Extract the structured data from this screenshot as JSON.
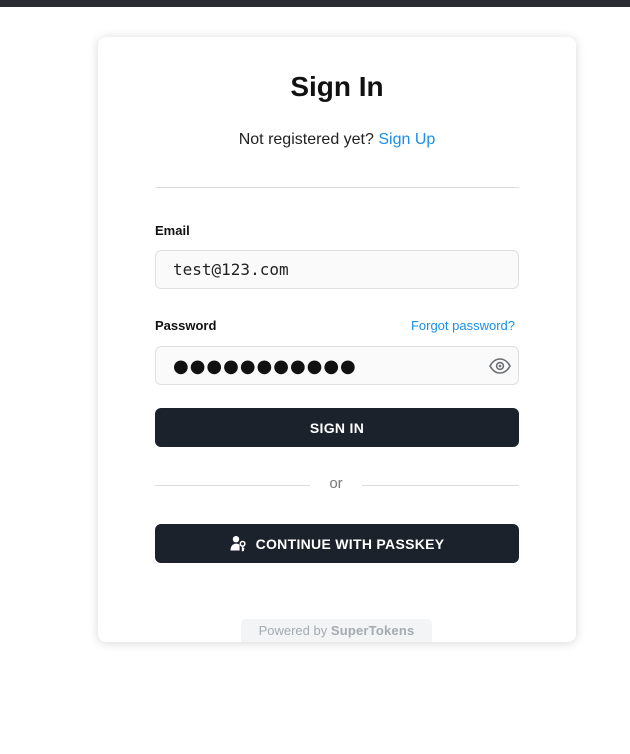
{
  "signin": {
    "title": "Sign In",
    "subtitle_prefix": "Not registered yet?",
    "signup_link": "Sign Up",
    "email_label": "Email",
    "email_value": "test@123.com",
    "password_label": "Password",
    "forgot_link": "Forgot password?",
    "password_masked": "●●●●●●●●●●●",
    "signin_button": "SIGN IN",
    "or_text": "or",
    "passkey_button": "CONTINUE WITH PASSKEY",
    "powered_prefix": "Powered by",
    "powered_brand": "SuperTokens"
  },
  "icons": {
    "eye": "eye-icon",
    "passkey": "user-key-icon"
  },
  "colors": {
    "link": "#1a8fe8",
    "button_bg": "#1c222b",
    "button_text": "#ffffff",
    "card_bg": "#ffffff",
    "input_bg": "#fafafa"
  }
}
